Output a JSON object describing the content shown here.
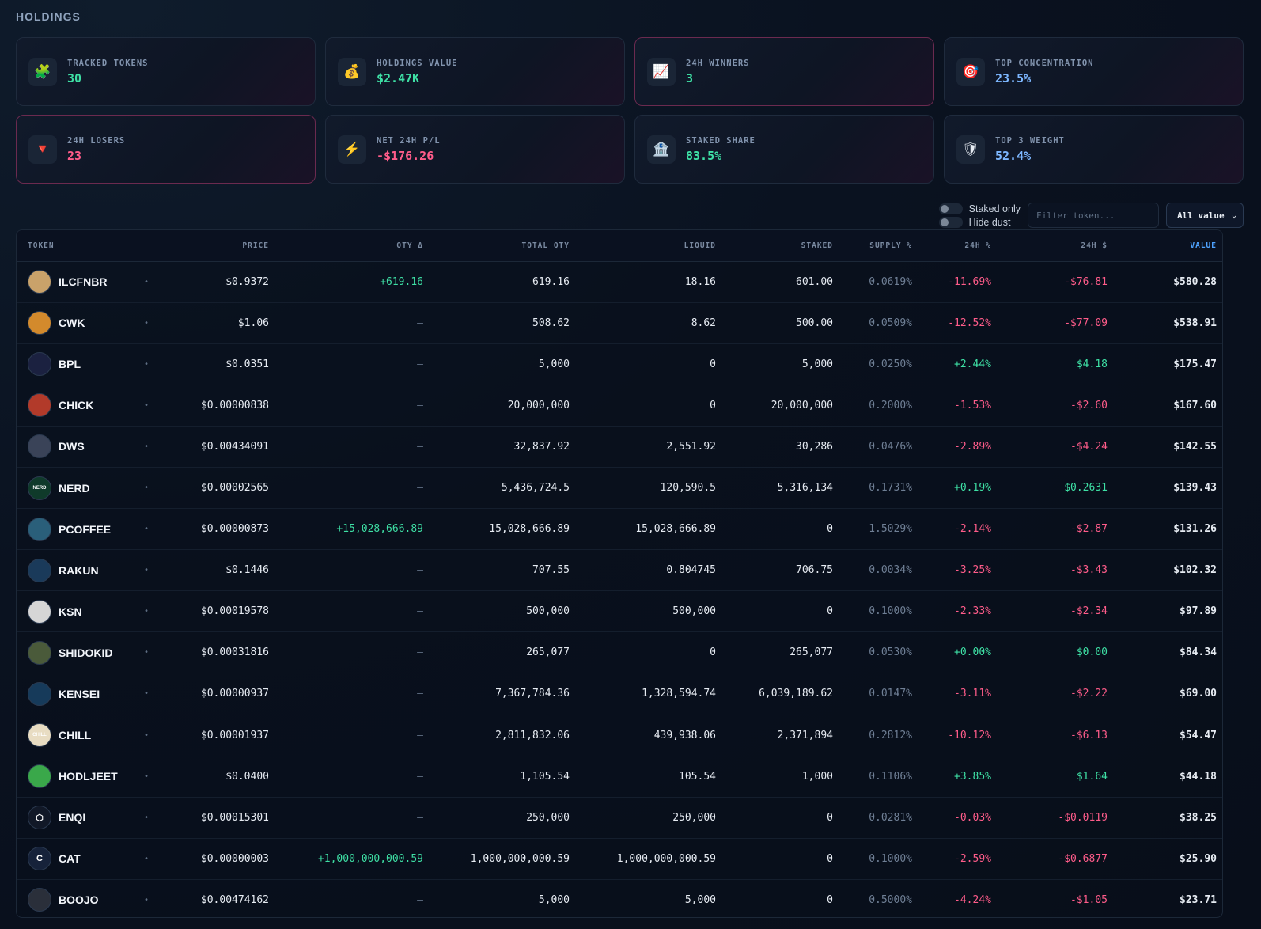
{
  "section_title": "HOLDINGS",
  "stats": [
    {
      "label": "TRACKED TOKENS",
      "value": "30",
      "icon": "🧩",
      "icon_name": "puzzle-icon",
      "tone": "c-green",
      "accent": false
    },
    {
      "label": "HOLDINGS VALUE",
      "value": "$2.47K",
      "icon": "💰",
      "icon_name": "money-bag-icon",
      "tone": "c-green",
      "accent": false
    },
    {
      "label": "24H WINNERS",
      "value": "3",
      "icon": "📈",
      "icon_name": "chart-up-icon",
      "tone": "c-green",
      "accent": true
    },
    {
      "label": "TOP CONCENTRATION",
      "value": "23.5%",
      "icon": "🎯",
      "icon_name": "target-icon",
      "tone": "c-blue",
      "accent": false
    },
    {
      "label": "24H LOSERS",
      "value": "23",
      "icon": "🔻",
      "icon_name": "down-triangle-icon",
      "tone": "c-red",
      "accent": true
    },
    {
      "label": "NET 24H P/L",
      "value": "-$176.26",
      "icon": "⚡",
      "icon_name": "lightning-icon",
      "tone": "c-red",
      "accent": false
    },
    {
      "label": "STAKED SHARE",
      "value": "83.5%",
      "icon": "🏦",
      "icon_name": "bank-icon",
      "tone": "c-green",
      "accent": false
    },
    {
      "label": "TOP 3 WEIGHT",
      "value": "52.4%",
      "icon": "🛡",
      "icon_name": "shield-icon",
      "tone": "c-blue",
      "accent": false
    }
  ],
  "controls": {
    "staked_only": "Staked only",
    "hide_dust": "Hide dust",
    "filter_placeholder": "Filter token...",
    "value_filter": "All value"
  },
  "columns": [
    "TOKEN",
    "",
    "PRICE",
    "QTY Δ",
    "TOTAL QTY",
    "LIQUID",
    "STAKED",
    "SUPPLY %",
    "24H %",
    "24H $",
    "VALUE"
  ],
  "rows": [
    {
      "symbol": "ILCFNBR",
      "avatar_color": "#c9a26a",
      "avatar_text": "",
      "price": "$0.9372",
      "qty_delta": "+619.16",
      "total_qty": "619.16",
      "liquid": "18.16",
      "staked": "601.00",
      "supply": "0.0619%",
      "change_pct": "-11.69%",
      "change_usd": "-$76.81",
      "value": "$580.28"
    },
    {
      "symbol": "CWK",
      "avatar_color": "#d38a2c",
      "avatar_text": "",
      "price": "$1.06",
      "qty_delta": "—",
      "total_qty": "508.62",
      "liquid": "8.62",
      "staked": "500.00",
      "supply": "0.0509%",
      "change_pct": "-12.52%",
      "change_usd": "-$77.09",
      "value": "$538.91"
    },
    {
      "symbol": "BPL",
      "avatar_color": "#1b2140",
      "avatar_text": "",
      "price": "$0.0351",
      "qty_delta": "—",
      "total_qty": "5,000",
      "liquid": "0",
      "staked": "5,000",
      "supply": "0.0250%",
      "change_pct": "+2.44%",
      "change_usd": "$4.18",
      "value": "$175.47"
    },
    {
      "symbol": "CHICK",
      "avatar_color": "#b23a2a",
      "avatar_text": "",
      "price": "$0.00000838",
      "qty_delta": "—",
      "total_qty": "20,000,000",
      "liquid": "0",
      "staked": "20,000,000",
      "supply": "0.2000%",
      "change_pct": "-1.53%",
      "change_usd": "-$2.60",
      "value": "$167.60"
    },
    {
      "symbol": "DWS",
      "avatar_color": "#3a4358",
      "avatar_text": "",
      "price": "$0.00434091",
      "qty_delta": "—",
      "total_qty": "32,837.92",
      "liquid": "2,551.92",
      "staked": "30,286",
      "supply": "0.0476%",
      "change_pct": "-2.89%",
      "change_usd": "-$4.24",
      "value": "$142.55"
    },
    {
      "symbol": "NERD",
      "avatar_color": "#0f3a2a",
      "avatar_text": "NERD",
      "price": "$0.00002565",
      "qty_delta": "—",
      "total_qty": "5,436,724.5",
      "liquid": "120,590.5",
      "staked": "5,316,134",
      "supply": "0.1731%",
      "change_pct": "+0.19%",
      "change_usd": "$0.2631",
      "value": "$139.43"
    },
    {
      "symbol": "PCOFFEE",
      "avatar_color": "#2a5f7a",
      "avatar_text": "",
      "price": "$0.00000873",
      "qty_delta": "+15,028,666.89",
      "total_qty": "15,028,666.89",
      "liquid": "15,028,666.89",
      "staked": "0",
      "supply": "1.5029%",
      "change_pct": "-2.14%",
      "change_usd": "-$2.87",
      "value": "$131.26"
    },
    {
      "symbol": "RAKUN",
      "avatar_color": "#1a3a5a",
      "avatar_text": "",
      "price": "$0.1446",
      "qty_delta": "—",
      "total_qty": "707.55",
      "liquid": "0.804745",
      "staked": "706.75",
      "supply": "0.0034%",
      "change_pct": "-3.25%",
      "change_usd": "-$3.43",
      "value": "$102.32"
    },
    {
      "symbol": "KSN",
      "avatar_color": "#d6d6d6",
      "avatar_text": "",
      "price": "$0.00019578",
      "qty_delta": "—",
      "total_qty": "500,000",
      "liquid": "500,000",
      "staked": "0",
      "supply": "0.1000%",
      "change_pct": "-2.33%",
      "change_usd": "-$2.34",
      "value": "$97.89"
    },
    {
      "symbol": "SHIDOKID",
      "avatar_color": "#4a5a3a",
      "avatar_text": "",
      "price": "$0.00031816",
      "qty_delta": "—",
      "total_qty": "265,077",
      "liquid": "0",
      "staked": "265,077",
      "supply": "0.0530%",
      "change_pct": "+0.00%",
      "change_usd": "$0.00",
      "value": "$84.34"
    },
    {
      "symbol": "KENSEI",
      "avatar_color": "#163a5a",
      "avatar_text": "",
      "price": "$0.00000937",
      "qty_delta": "—",
      "total_qty": "7,367,784.36",
      "liquid": "1,328,594.74",
      "staked": "6,039,189.62",
      "supply": "0.0147%",
      "change_pct": "-3.11%",
      "change_usd": "-$2.22",
      "value": "$69.00"
    },
    {
      "symbol": "CHILL",
      "avatar_color": "#e8dcc2",
      "avatar_text": "CHILL",
      "price": "$0.00001937",
      "qty_delta": "—",
      "total_qty": "2,811,832.06",
      "liquid": "439,938.06",
      "staked": "2,371,894",
      "supply": "0.2812%",
      "change_pct": "-10.12%",
      "change_usd": "-$6.13",
      "value": "$54.47"
    },
    {
      "symbol": "HODLJEET",
      "avatar_color": "#3aa84a",
      "avatar_text": "",
      "price": "$0.0400",
      "qty_delta": "—",
      "total_qty": "1,105.54",
      "liquid": "105.54",
      "staked": "1,000",
      "supply": "0.1106%",
      "change_pct": "+3.85%",
      "change_usd": "$1.64",
      "value": "$44.18"
    },
    {
      "symbol": "ENQI",
      "avatar_color": "#111827",
      "avatar_text": "⬡",
      "price": "$0.00015301",
      "qty_delta": "—",
      "total_qty": "250,000",
      "liquid": "250,000",
      "staked": "0",
      "supply": "0.0281%",
      "change_pct": "-0.03%",
      "change_usd": "-$0.0119",
      "value": "$38.25"
    },
    {
      "symbol": "CAT",
      "avatar_color": "#16223a",
      "avatar_text": "C",
      "price": "$0.00000003",
      "qty_delta": "+1,000,000,000.59",
      "total_qty": "1,000,000,000.59",
      "liquid": "1,000,000,000.59",
      "staked": "0",
      "supply": "0.1000%",
      "change_pct": "-2.59%",
      "change_usd": "-$0.6877",
      "value": "$25.90"
    },
    {
      "symbol": "BOOJO",
      "avatar_color": "#2a2f3a",
      "avatar_text": "",
      "price": "$0.00474162",
      "qty_delta": "—",
      "total_qty": "5,000",
      "liquid": "5,000",
      "staked": "0",
      "supply": "0.5000%",
      "change_pct": "-4.24%",
      "change_usd": "-$1.05",
      "value": "$23.71"
    }
  ],
  "row_marker": "•",
  "colors": {
    "positive": "#3ee0a5",
    "negative": "#ff5c8a",
    "accent": "#4fa3ff"
  }
}
